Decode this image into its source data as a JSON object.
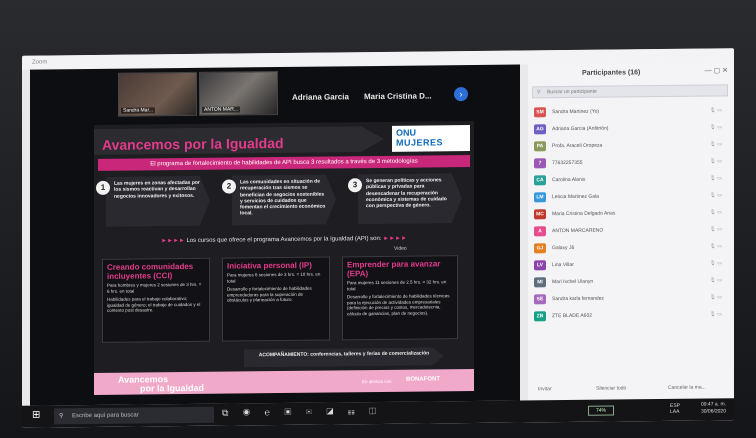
{
  "window": {
    "app_title": "Zoom"
  },
  "gallery": {
    "tiles": [
      {
        "label": "Sandra Mar..."
      },
      {
        "label": "ANTON MAR..."
      }
    ],
    "names": [
      "Adriana Garcia",
      "Maria Cristina D..."
    ],
    "next_icon": "chevron-right-icon"
  },
  "slide": {
    "title": "Avancemos por la Igualdad",
    "logo_line1": "ONU",
    "logo_line2": "MUJERES",
    "subtitle": "El programa de fortalecimiento de habilidades de API busca 3 resultados a través de 3 metodologías",
    "steps": [
      {
        "num": "1",
        "text": "Las mujeres en zonas afectadas por los sismos reactivan y desarrollan negocios innovadores y exitosos."
      },
      {
        "num": "2",
        "text": "Las comunidades en situación de recuperación tras sismos se benefician de negocios sostenibles y servicios de cuidados que fomentan el crecimiento económico local."
      },
      {
        "num": "3",
        "text": "Se generan políticas y acciones públicas y privadas para desencadenar la recuperación económica y sistemas de cuidado con perspectiva de género."
      }
    ],
    "courses_line": "Los cursos que ofrece el programa Avancemos por la Igualdad (API) son:",
    "arrows": "►►►►",
    "cards": [
      {
        "title": "Creando comunidades incluyentes (CCI)",
        "schedule": "Para hombres y mujeres 2 sesiones de 3 hrs. = 6 hrs. en total",
        "desc": "Habilidades para el trabajo colaborativo; igualdad de género; el trabajo de cuidados y el contexto post desastre."
      },
      {
        "title": "Iniciativa personal (IP)",
        "schedule": "Para mujeres 6 sesiones de 3 hrs. = 18 hrs. en total",
        "desc": "Desarrollo y fortalecimiento de habilidades emprendedoras para la superación de obstáculos y planeación a futuro."
      },
      {
        "title": "Emprender para avanzar (EPA)",
        "schedule": "Para mujeres 11 sesiones de 2.5 hrs. = 32 hrs. en total",
        "desc": "Desarrollo y fortalecimiento de habilidades técnicas para la ejecución de actividades empresariales (definición de precios y costos, mercadotecnia, cálculo de ganancias, plan de negocios)."
      }
    ],
    "video_label": "Video",
    "accompaniment": "ACOMPAÑAMIENTO: conferencias, talleres y ferias de comercialización",
    "footer": {
      "brand_line1": "Avancemos",
      "brand_line2": "por la Igualdad",
      "alliance": "En alianza con",
      "partner": "BONAFONT"
    }
  },
  "participants": {
    "header": "Participantes (16)",
    "search_placeholder": "Buscar un participante",
    "list": [
      {
        "initials": "SM",
        "name": "Sandra Martinez (Yo)",
        "color": "#d9534f"
      },
      {
        "initials": "AG",
        "name": "Adriana Garcia (Anfitrión)",
        "color": "#6b5fc4"
      },
      {
        "initials": "PA",
        "name": "Profa. Araceli Oropeza",
        "color": "#8a9a5b"
      },
      {
        "initials": "7",
        "name": "77632257355",
        "color": "#9b59b6"
      },
      {
        "initials": "CA",
        "name": "Carolina Alanis",
        "color": "#2aa198"
      },
      {
        "initials": "LM",
        "name": "Leticia Martinez Gala",
        "color": "#3498db"
      },
      {
        "initials": "MC",
        "name": "Maria Cristina Delgado Arias",
        "color": "#c0392b"
      },
      {
        "initials": "A",
        "name": "ANTON MARCARENO",
        "color": "#e74c8c"
      },
      {
        "initials": "GJ",
        "name": "Galaxy J6",
        "color": "#e67e22"
      },
      {
        "initials": "LV",
        "name": "Lina Villar",
        "color": "#8e44ad"
      },
      {
        "initials": "MI",
        "name": "Mari Ixchel Ulanyn",
        "color": "#5d6d7e"
      },
      {
        "initials": "SE",
        "name": "Sandra karla fernandez",
        "color": "#a569bd"
      },
      {
        "initials": "ZB",
        "name": "ZTE BLADE A602",
        "color": "#16a085"
      }
    ],
    "footer_actions": [
      "Invitar",
      "Silenciar todo",
      "Cancelar la ma..."
    ]
  },
  "taskbar": {
    "search_placeholder": "Escribe aquí para buscar",
    "lang": "ESP",
    "lang2": "LAA",
    "time": "09:47 a. m.",
    "date": "30/06/2020",
    "battery": "74%"
  }
}
